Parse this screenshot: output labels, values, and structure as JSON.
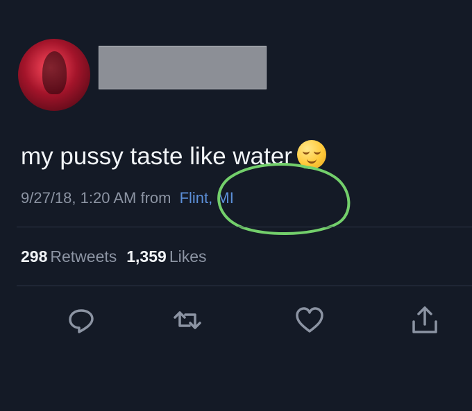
{
  "profile": {
    "name_redacted": true
  },
  "tweet": {
    "text": "my pussy taste like water",
    "emoji": "relieved-face-emoji",
    "timestamp": "9/27/18, 1:20 AM",
    "from_label": "from",
    "location": "Flint, MI"
  },
  "stats": {
    "retweets_count": "298",
    "retweets_label": "Retweets",
    "likes_count": "1,359",
    "likes_label": "Likes"
  },
  "actions": {
    "reply_icon": "reply-icon",
    "retweet_icon": "retweet-icon",
    "like_icon": "heart-icon",
    "share_icon": "share-icon"
  },
  "colors": {
    "background": "#141a26",
    "text": "#f1f4f7",
    "muted": "#8c94a3",
    "link": "#5c8fd8",
    "annotation": "#73cf6b"
  }
}
